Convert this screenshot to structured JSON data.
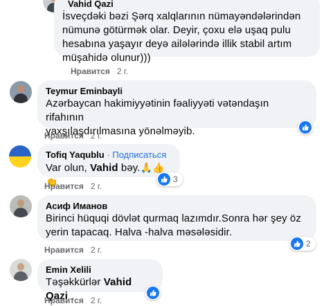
{
  "comments": [
    {
      "author": "Vahid Qazi",
      "lines": [
        "İsveçdəki bəzi Şərq xalqlarının nümayəndələrindən",
        "nümunə götürmək olar. Deyir, çoxu elə uşaq pulu",
        "hesabına yaşayır deyə ailələrində illik stabil artım",
        "müşahidə olunur)))"
      ],
      "like_label": "Нравится",
      "time": "2 г."
    },
    {
      "author": "Teymur Eminbayli",
      "lines": [
        "Azərbaycan hakimiyyətinin fəaliyyəti vətəndaşın rifahının",
        "yaxşılaşdırılmasına yönəlməyib."
      ],
      "like_label": "Нравится",
      "time": "2 г."
    },
    {
      "author": "Tofiq Yaqublu",
      "subscribe": "Подписаться",
      "text_pre": "Var olun, ",
      "text_mention": "Vahid",
      "text_post": " bəy.",
      "emojis": "🙏👍👏",
      "like_label": "Нравится",
      "time": "2 г.",
      "reactions": "3"
    },
    {
      "author": "Асиф Иманов",
      "lines": [
        "Birinci hüquqi dövlət qurmaq lazımdır.Sonra hər şey öz",
        "yerin tapacaq. Halva -halva məsələsidir."
      ],
      "like_label": "Нравится",
      "time": "2 г.",
      "reactions": "2"
    },
    {
      "author": "Emin Xelili",
      "text_pre": "Təşəkkürlər ",
      "text_mention": "Vahid Qazi",
      "text_post": " .",
      "like_label": "Нравится",
      "time": "2 г."
    }
  ],
  "colors": {
    "bubble": "#f0f2f5",
    "like_blue": "#1877f2",
    "meta_gray": "#65676b",
    "link_blue": "#216fdb"
  }
}
